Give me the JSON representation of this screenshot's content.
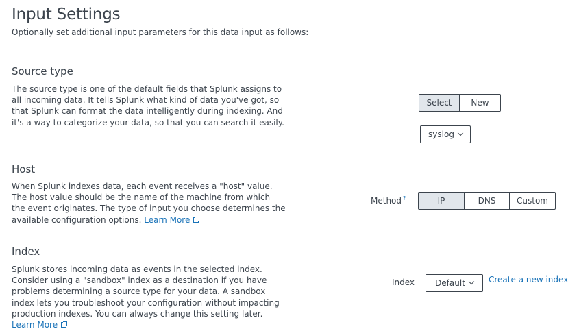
{
  "page": {
    "title": "Input Settings",
    "subtitle": "Optionally set additional input parameters for this data input as follows:"
  },
  "source_type": {
    "title": "Source type",
    "description": "The source type is one of the default fields that Splunk assigns to all incoming data. It tells Splunk what kind of data you've got, so that Splunk can format the data intelligently during indexing. And it's a way to categorize your data, so that you can search it easily.",
    "toggle": [
      "Select",
      "New"
    ],
    "active": "Select",
    "dropdown_value": "syslog",
    "dropdown_icon": "chevron-down-icon"
  },
  "host": {
    "title": "Host",
    "description": "When Splunk indexes data, each event receives a \"host\" value. The host value should be the name of the machine from which the event originates. The type of input you choose determines the available configuration options.",
    "learn_more": "Learn More",
    "method_label": "Method",
    "help_mark": "?",
    "options": [
      "IP",
      "DNS",
      "Custom"
    ],
    "active": "IP"
  },
  "index": {
    "title": "Index",
    "description": "Splunk stores incoming data as events in the selected index. Consider using a \"sandbox\" index as a destination if you have problems determining a source type for your data. A sandbox index lets you troubleshoot your configuration without impacting production indexes. You can always change this setting later.",
    "learn_more": "Learn More",
    "label": "Index",
    "dropdown_value": "Default",
    "create_link": "Create a new index"
  },
  "colors": {
    "text": "#3c444d",
    "link": "#1a73b8",
    "active_segment": "#e1e6eb"
  }
}
